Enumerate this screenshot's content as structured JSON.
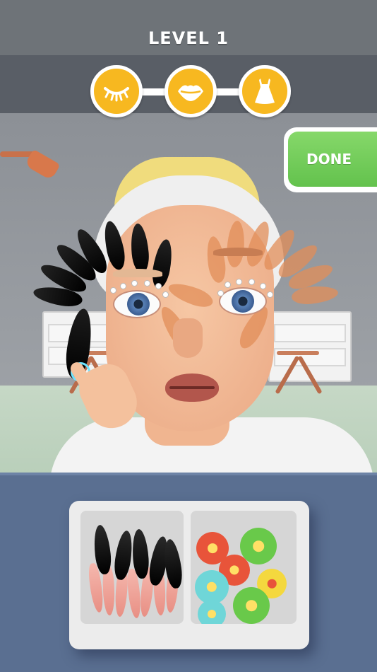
{
  "hud": {
    "level_label": "LEVEL 1",
    "steps": [
      {
        "name": "eyelash-step",
        "icon": "closed-eye-icon",
        "state": "current"
      },
      {
        "name": "lips-step",
        "icon": "lips-icon",
        "state": "upcoming"
      },
      {
        "name": "dress-step",
        "icon": "dress-icon",
        "state": "upcoming"
      }
    ],
    "done_label": "DONE"
  },
  "colors": {
    "step_fill": "#f7b820",
    "done_green": "#63c24d",
    "table": "#5a6f91"
  },
  "tray": {
    "left_compartment": "eyelash-petals",
    "right_compartment": "flower-decorations"
  }
}
